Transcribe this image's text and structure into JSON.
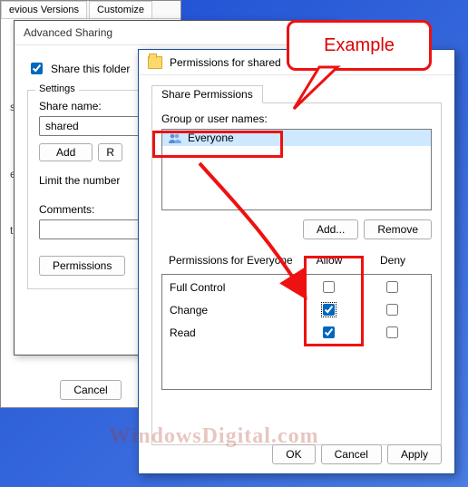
{
  "props": {
    "tabs": {
      "prev": "evious Versions",
      "customize": "Customize"
    },
    "text1": "s\\",
    "text2": "e",
    "text3": "t a",
    "cancel": "Cancel"
  },
  "adv": {
    "title": "Advanced Sharing",
    "shareFolder": "Share this folder",
    "settings": "Settings",
    "shareNameLabel": "Share name:",
    "shareName": "shared",
    "add": "Add",
    "remove": "R",
    "limitText": "Limit the number",
    "commentsLabel": "Comments:",
    "permissionsBtn": "Permissions"
  },
  "perm": {
    "title": "Permissions for shared",
    "tab": "Share Permissions",
    "groupLabel": "Group or user names:",
    "everyone": "Everyone",
    "addBtn": "Add...",
    "removeBtn": "Remove",
    "permForLabel": "Permissions for Everyone",
    "colAllow": "Allow",
    "colDeny": "Deny",
    "rows": {
      "fullControl": "Full Control",
      "change": "Change",
      "read": "Read"
    },
    "ok": "OK",
    "cancel": "Cancel",
    "apply": "Apply"
  },
  "annot": {
    "callout": "Example",
    "watermark": "WindowsDigital.com"
  }
}
